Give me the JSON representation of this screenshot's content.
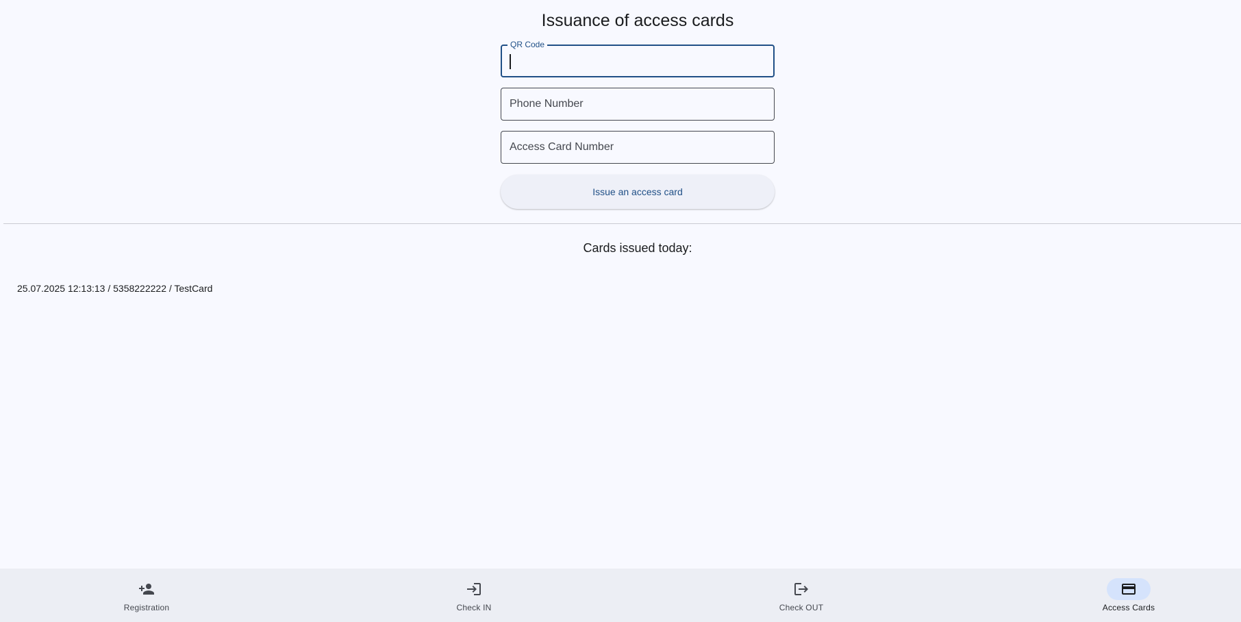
{
  "page": {
    "title": "Issuance of access cards"
  },
  "form": {
    "qr_code": {
      "label": "QR Code",
      "value": ""
    },
    "phone_number": {
      "placeholder": "Phone Number",
      "value": ""
    },
    "access_card_number": {
      "placeholder": "Access Card Number",
      "value": ""
    },
    "issue_button_label": "Issue an access card"
  },
  "issued": {
    "heading": "Cards issued today:",
    "items": [
      "25.07.2025 12:13:13 / 5358222222 / TestCard"
    ]
  },
  "nav": {
    "items": [
      {
        "label": "Registration",
        "icon": "person-add-icon",
        "active": false
      },
      {
        "label": "Check IN",
        "icon": "login-icon",
        "active": false
      },
      {
        "label": "Check OUT",
        "icon": "logout-icon",
        "active": false
      },
      {
        "label": "Access Cards",
        "icon": "credit-card-icon",
        "active": true
      }
    ]
  },
  "colors": {
    "background": "#f8f9ff",
    "primary": "#1f4f86",
    "nav_background": "#eceef4",
    "active_indicator": "#d5e3fc"
  }
}
